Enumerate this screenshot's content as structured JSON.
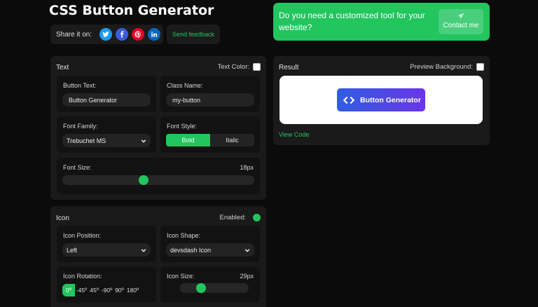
{
  "header": {
    "title": "CSS Button Generator",
    "share_label": "Share it on:",
    "social": [
      {
        "icon": "twitter-icon",
        "color": "#1d9bf0"
      },
      {
        "icon": "facebook-icon",
        "color": "#1877f2"
      },
      {
        "icon": "pinterest-icon",
        "color": "#e60023"
      },
      {
        "icon": "linkedin-icon",
        "color": "#0a66c2"
      }
    ],
    "feedback_label": "Send feedback"
  },
  "promo": {
    "text": "Do you need a customized tool for your website?",
    "contact_label": "Contact me",
    "icon": "paper-plane-icon",
    "color": "#22c55e"
  },
  "text_panel": {
    "title": "Text",
    "text_color_label": "Text Color:",
    "button_text_label": "Button Text:",
    "button_text_value": "Button Generator",
    "class_name_label": "Class Name:",
    "class_name_value": "my-button",
    "font_family_label": "Font Family:",
    "font_family_value": "Trebuchet MS",
    "font_style_label": "Font Style:",
    "font_style_options": [
      "Bold",
      "Italic"
    ],
    "font_style_selected": "Bold",
    "font_size_label": "Font Size:",
    "font_size_value": "18px",
    "font_size_fraction": 0.42
  },
  "icon_panel": {
    "title": "Icon",
    "enabled_label": "Enabled:",
    "position_label": "Icon Position:",
    "position_value": "Left",
    "shape_label": "Icon Shape:",
    "shape_value": "devsdash Icon",
    "rotation_label": "Icon Rotation:",
    "rotation_options": [
      "0º",
      "-45º",
      "45º",
      "-90º",
      "90º",
      "180º"
    ],
    "rotation_selected": "0º",
    "size_label": "Icon Size:",
    "size_value": "29px",
    "size_fraction": 0.27
  },
  "result_panel": {
    "title": "Result",
    "preview_bg_label": "Preview Background:",
    "demo_button_text": "Button Generator",
    "demo_button_icon": "code-brackets-icon",
    "view_code_label": "View Code"
  },
  "colors": {
    "accent": "#22c55e",
    "demo_gradient_start": "#2f5ee0",
    "demo_gradient_end": "#6a35e8"
  }
}
